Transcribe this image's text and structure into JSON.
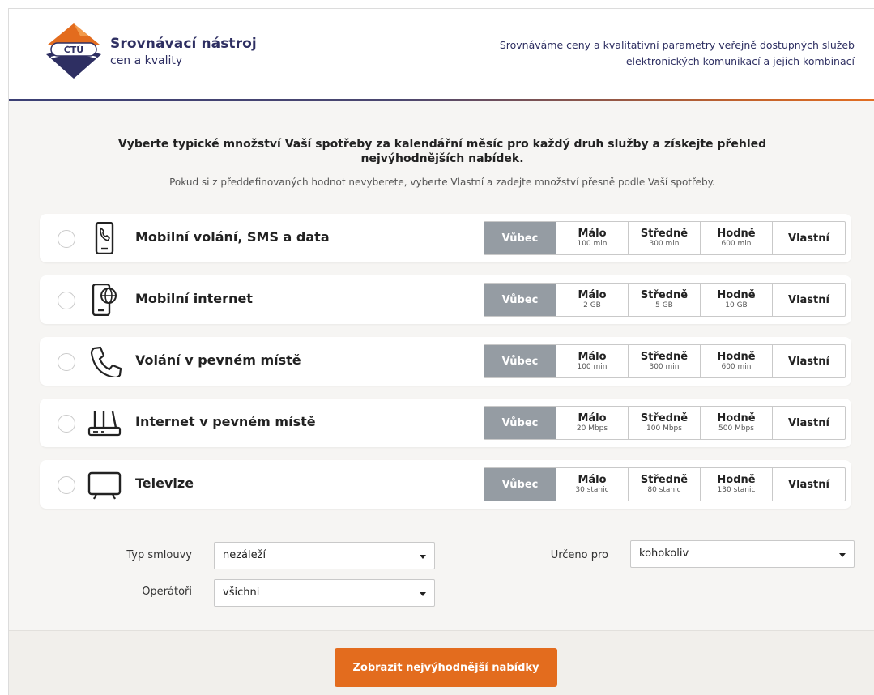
{
  "header": {
    "logo_text": "ČTÚ",
    "brand_title": "Srovnávací nástroj",
    "brand_subtitle": "cen a kvality",
    "tagline_line1": "Srovnáváme ceny a kvalitativní parametry veřejně dostupných služeb",
    "tagline_line2": "elektronických komunikací a jejich kombinací"
  },
  "intro": {
    "title": "Vyberte typické množství Vaší spotřeby za kalendářní měsíc pro každý druh služby a získejte přehled nejvýhodnějších nabídek.",
    "note": "Pokud si z předdefinovaných hodnot nevyberete, vyberte Vlastní a zadejte množství přesně podle Vaší spotřeby."
  },
  "services": [
    {
      "name": "Mobilní volání, SMS a data",
      "icon": "mobile-call-icon",
      "options": [
        {
          "label": "Vůbec",
          "sub": ""
        },
        {
          "label": "Málo",
          "sub": "100 min"
        },
        {
          "label": "Středně",
          "sub": "300 min"
        },
        {
          "label": "Hodně",
          "sub": "600 min"
        },
        {
          "label": "Vlastní",
          "sub": ""
        }
      ]
    },
    {
      "name": "Mobilní internet",
      "icon": "mobile-internet-icon",
      "options": [
        {
          "label": "Vůbec",
          "sub": ""
        },
        {
          "label": "Málo",
          "sub": "2 GB"
        },
        {
          "label": "Středně",
          "sub": "5 GB"
        },
        {
          "label": "Hodně",
          "sub": "10 GB"
        },
        {
          "label": "Vlastní",
          "sub": ""
        }
      ]
    },
    {
      "name": "Volání v pevném místě",
      "icon": "phone-handset-icon",
      "options": [
        {
          "label": "Vůbec",
          "sub": ""
        },
        {
          "label": "Málo",
          "sub": "100 min"
        },
        {
          "label": "Středně",
          "sub": "300 min"
        },
        {
          "label": "Hodně",
          "sub": "600 min"
        },
        {
          "label": "Vlastní",
          "sub": ""
        }
      ]
    },
    {
      "name": "Internet v pevném místě",
      "icon": "router-icon",
      "options": [
        {
          "label": "Vůbec",
          "sub": ""
        },
        {
          "label": "Málo",
          "sub": "20 Mbps"
        },
        {
          "label": "Středně",
          "sub": "100 Mbps"
        },
        {
          "label": "Hodně",
          "sub": "500 Mbps"
        },
        {
          "label": "Vlastní",
          "sub": ""
        }
      ]
    },
    {
      "name": "Televize",
      "icon": "tv-icon",
      "options": [
        {
          "label": "Vůbec",
          "sub": ""
        },
        {
          "label": "Málo",
          "sub": "30 stanic"
        },
        {
          "label": "Středně",
          "sub": "80 stanic"
        },
        {
          "label": "Hodně",
          "sub": "130 stanic"
        },
        {
          "label": "Vlastní",
          "sub": ""
        }
      ]
    }
  ],
  "filters": {
    "contract_label": "Typ smlouvy",
    "contract_value": "nezáleží",
    "operators_label": "Operátoři",
    "operators_value": "všichni",
    "target_label": "Určeno pro",
    "target_value": "kohokoliv"
  },
  "cta_label": "Zobrazit nejvýhodnější nabídky",
  "colors": {
    "brand_navy": "#2e2f62",
    "accent_orange": "#e36c1e",
    "selected_option": "#959ca3"
  }
}
